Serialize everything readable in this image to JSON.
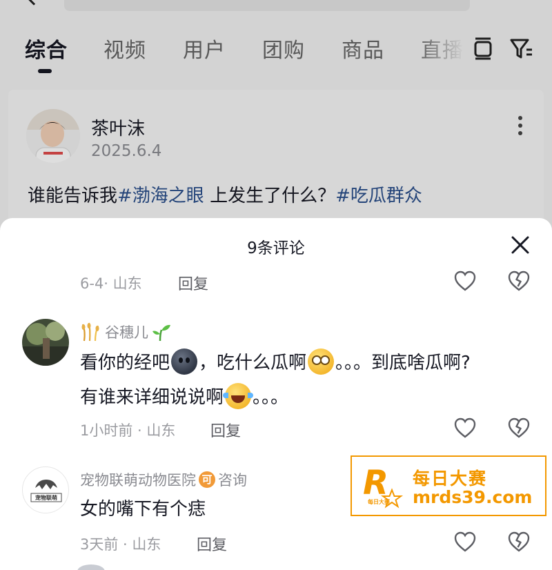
{
  "search": {
    "placeholder": ""
  },
  "tabs": [
    {
      "label": "综合"
    },
    {
      "label": "视频"
    },
    {
      "label": "用户"
    },
    {
      "label": "团购"
    },
    {
      "label": "商品"
    },
    {
      "label": "直播"
    }
  ],
  "post": {
    "author": "茶叶沫",
    "date": "2025.6.4",
    "text_prefix": "谁能告诉我",
    "hashtag1": "#渤海之眼",
    "text_middle": " 上发生了什么？",
    "hashtag2": "#吃瓜群众"
  },
  "sheet": {
    "title": "9条评论",
    "first_meta": "6-4· 山东",
    "reply_label": "回复"
  },
  "comments": [
    {
      "name": "谷穗儿",
      "line1_a": "看你的经吧",
      "line1_b": "，吃什么瓜啊",
      "line1_c": "。。。到底啥瓜啊?",
      "line2_a": "有谁来详细说说啊",
      "line2_b": "。。。",
      "meta": "1小时前 · 山东"
    },
    {
      "name": "宠物联萌动物医院",
      "badge": "可",
      "name_suffix": "咨询",
      "avatar_text": "宠物联萌",
      "text": "女的嘴下有个痣",
      "meta": "3天前 · 山东"
    }
  ],
  "watermark": {
    "logo_letter": "R",
    "logo_small": "每日大赛",
    "title": "每日大赛",
    "domain": "mrds39.com"
  },
  "colors": {
    "hashtag": "#2a4f8c",
    "watermark": "#f39800",
    "text": "#161823",
    "meta": "#9a9ba0"
  }
}
